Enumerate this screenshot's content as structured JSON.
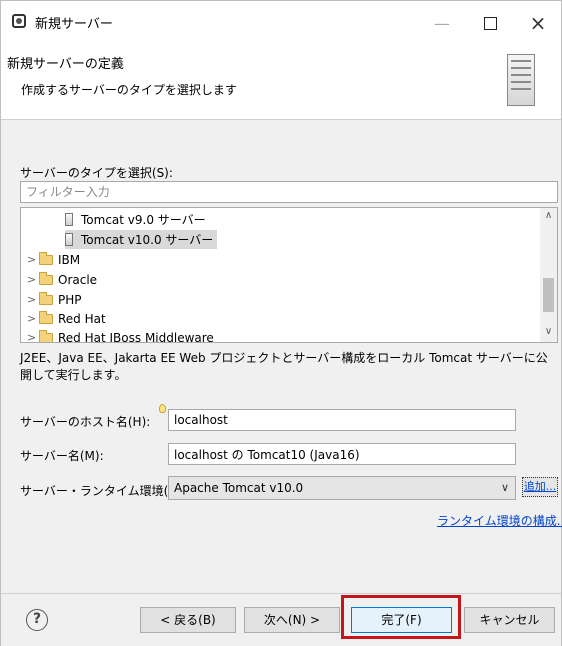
{
  "window": {
    "title": "新規サーバー"
  },
  "header": {
    "title": "新規サーバーの定義",
    "description": "作成するサーバーのタイプを選択します"
  },
  "server_type": {
    "label": "サーバーのタイプを選択(S):",
    "filter_placeholder": "フィルター入力",
    "tree_items": [
      {
        "label": "Tomcat v9.0 サーバー",
        "kind": "server-icon"
      },
      {
        "label": "Tomcat v10.0 サーバー",
        "kind": "server-icon",
        "selected": true
      },
      {
        "label": "IBM",
        "kind": "folder-icon"
      },
      {
        "label": "Oracle",
        "kind": "folder-icon"
      },
      {
        "label": "PHP",
        "kind": "folder-icon"
      },
      {
        "label": "Red Hat",
        "kind": "folder-icon"
      },
      {
        "label": "Red Hat JBoss Middleware",
        "kind": "folder-icon"
      }
    ],
    "description": "J2EE、Java EE、Jakarta EE Web プロジェクトとサーバー構成をローカル Tomcat サーバーに公開して実行します。"
  },
  "form": {
    "host_label": "サーバーのホスト名(H):",
    "host_value": "localhost",
    "name_label": "サーバー名(M):",
    "name_value": "localhost の Tomcat10 (Java16)",
    "runtime_label": "サーバー・ランタイム環境(R):",
    "runtime_value": "Apache Tomcat v10.0",
    "add_label": "追加...",
    "configure_link": "ランタイム環境の構成..."
  },
  "buttons": {
    "back": "< 戻る(B)",
    "next": "次へ(N) >",
    "finish": "完了(F)",
    "cancel": "キャンセル"
  },
  "colors": {
    "highlight": "#c4161c",
    "link": "#0044cc"
  }
}
